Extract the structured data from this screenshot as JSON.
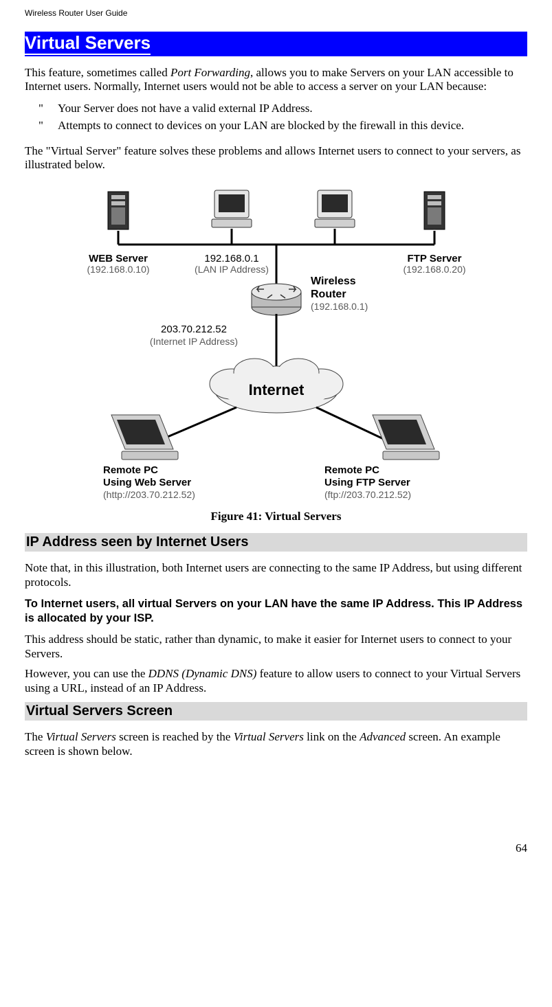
{
  "running_header": "Wireless Router User Guide",
  "section_title": "Virtual Servers",
  "intro_p1_a": "This feature, sometimes called ",
  "intro_p1_em": "Port Forwarding",
  "intro_p1_b": ", allows you to make Servers on your LAN accessible to Internet users. Normally, Internet users would not be able to access a server on your LAN because:",
  "bullets": {
    "b1": "Your Server does not have a valid external IP Address.",
    "b2": "Attempts to connect to devices on your LAN are blocked by the firewall in this device."
  },
  "intro_p2": "The \"Virtual Server\" feature solves these problems and allows Internet users to connect to your servers, as illustrated below.",
  "figure": {
    "caption": "Figure 41: Virtual Servers",
    "web_server_label": "WEB Server",
    "web_server_ip": "(192.168.0.10)",
    "lan_ip_label": "192.168.0.1",
    "lan_ip_sub": "(LAN IP Address)",
    "ftp_server_label": "FTP Server",
    "ftp_server_ip": "(192.168.0.20)",
    "router_label_l1": "Wireless",
    "router_label_l2": "Router",
    "router_ip": "(192.168.0.1)",
    "inet_ip": "203.70.212.52",
    "inet_ip_sub": "(Internet IP Address)",
    "internet": "Internet",
    "remote_left_l1": "Remote PC",
    "remote_left_l2": "Using Web Server",
    "remote_left_url": "(http://203.70.212.52)",
    "remote_right_l1": "Remote PC",
    "remote_right_l2": "Using FTP Server",
    "remote_right_url": "(ftp://203.70.212.52)"
  },
  "subhead1": "IP Address seen by Internet Users",
  "sub1_p1": "Note that, in this illustration, both Internet users are connecting to the same IP Address, but using different protocols.",
  "sub1_callout": "To Internet users, all virtual Servers on your LAN have the same IP Address. This IP Address is allocated by your ISP.",
  "sub1_p2": "This address should be static, rather than dynamic, to make it easier for Internet users to connect to your Servers.",
  "sub1_p3_a": "However, you can use the ",
  "sub1_p3_em": "DDNS (Dynamic DNS)",
  "sub1_p3_b": " feature to allow users to connect to your Virtual Servers using a URL, instead of an IP Address.",
  "subhead2": "Virtual Servers Screen",
  "sub2_p1_a": "The ",
  "sub2_p1_em1": "Virtual Servers",
  "sub2_p1_b": " screen is reached by the ",
  "sub2_p1_em2": "Virtual Servers",
  "sub2_p1_c": " link on the ",
  "sub2_p1_em3": "Advanced",
  "sub2_p1_d": " screen. An example screen is shown below.",
  "page_number": "64"
}
